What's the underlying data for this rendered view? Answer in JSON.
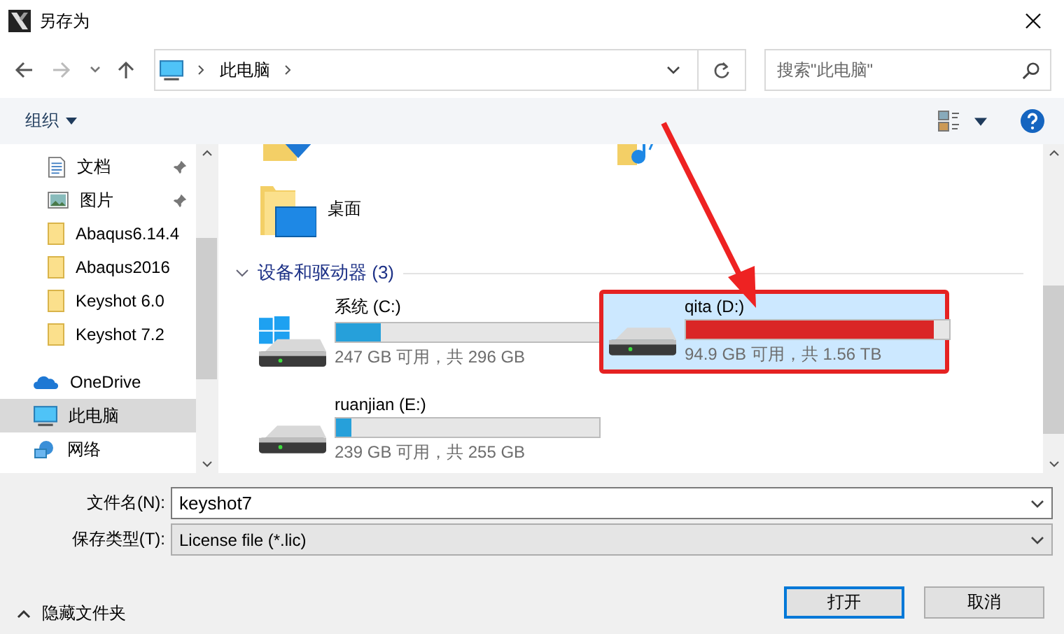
{
  "window": {
    "title": "另存为"
  },
  "nav": {
    "path": [
      "此电脑"
    ],
    "search": {
      "placeholder": "搜索\"此电脑\""
    }
  },
  "toolbar": {
    "organize": "组织"
  },
  "sidebar": {
    "items": [
      {
        "label": "文档",
        "kind": "document",
        "pinned": true,
        "selected": false
      },
      {
        "label": "图片",
        "kind": "pictures",
        "pinned": true,
        "selected": false
      },
      {
        "label": "Abaqus6.14.4",
        "kind": "folder",
        "pinned": false,
        "selected": false
      },
      {
        "label": "Abaqus2016",
        "kind": "folder",
        "pinned": false,
        "selected": false
      },
      {
        "label": "Keyshot 6.0",
        "kind": "folder",
        "pinned": false,
        "selected": false
      },
      {
        "label": "Keyshot 7.2",
        "kind": "folder",
        "pinned": false,
        "selected": false
      },
      {
        "label": "OneDrive",
        "kind": "cloud",
        "pinned": false,
        "selected": false
      },
      {
        "label": "此电脑",
        "kind": "computer",
        "pinned": false,
        "selected": true
      },
      {
        "label": "网络",
        "kind": "network",
        "pinned": false,
        "selected": false
      }
    ]
  },
  "folders": [
    {
      "kind": "downloads"
    },
    {
      "kind": "music"
    },
    {
      "kind": "desktop",
      "label": "桌面"
    }
  ],
  "group": {
    "title": "设备和驱动器 (3)",
    "expanded": true
  },
  "drives": [
    {
      "name": "系统 (C:)",
      "kind": "windows",
      "level": 0.17,
      "color": "#26a0da",
      "free": "247 GB 可用，共 296 GB",
      "selected": false,
      "highlighted": false
    },
    {
      "name": "qita (D:)",
      "kind": "disk",
      "level": 0.94,
      "color": "#da2626",
      "free": "94.9 GB 可用，共 1.56 TB",
      "selected": true,
      "highlighted": true
    },
    {
      "name": "ruanjian (E:)",
      "kind": "disk",
      "level": 0.06,
      "color": "#26a0da",
      "free": "239 GB 可用，共 255 GB",
      "selected": false,
      "highlighted": false
    }
  ],
  "file_name": {
    "label": "文件名(N):",
    "value": "keyshot7"
  },
  "file_type": {
    "label": "保存类型(T):",
    "value": "License file (*.lic)"
  },
  "hide_folders": "隐藏文件夹",
  "buttons": [
    {
      "label": "打开",
      "default": true
    },
    {
      "label": "取消",
      "default": false
    }
  ]
}
